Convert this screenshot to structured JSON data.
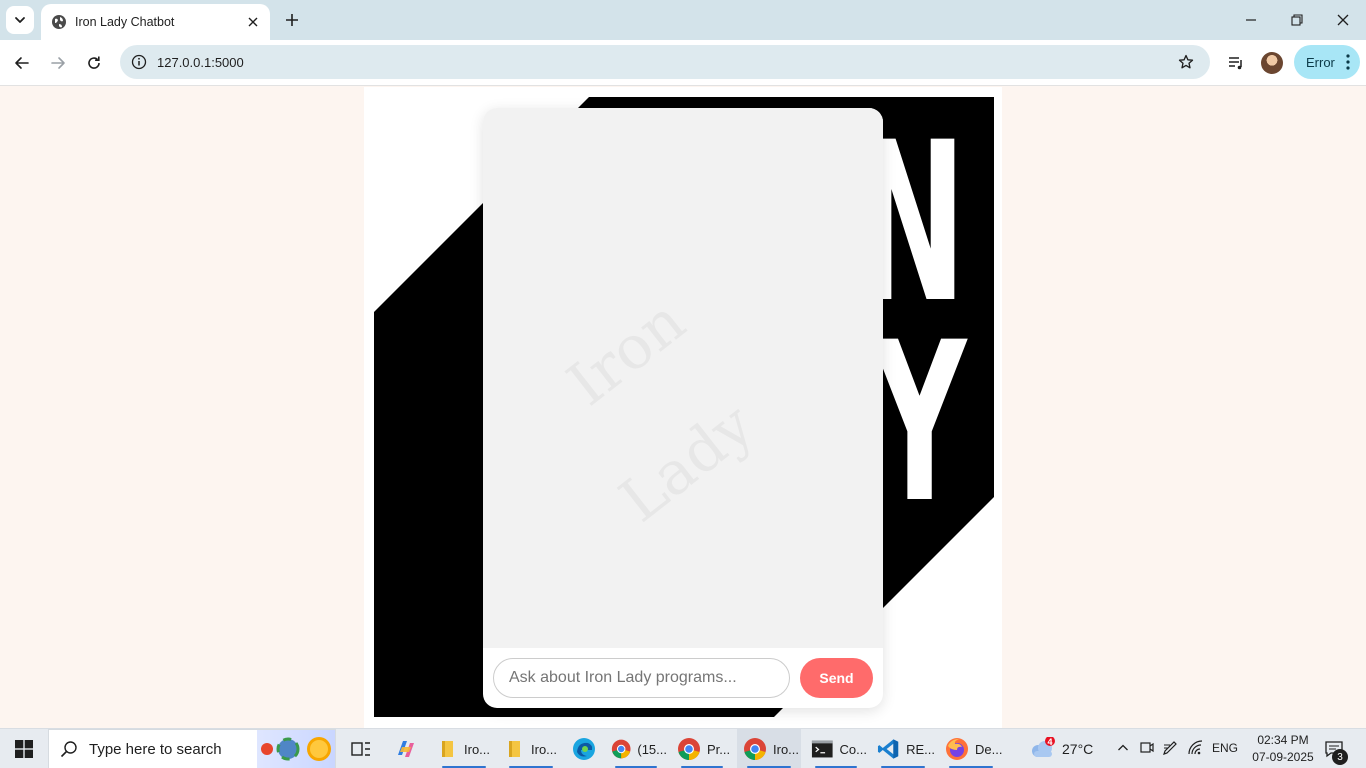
{
  "browser": {
    "tab": {
      "title": "Iron Lady Chatbot"
    },
    "address": {
      "url": "127.0.0.1:5000"
    },
    "profile_status": "Error"
  },
  "page": {
    "logo_text": [
      "IRON",
      "LADY"
    ],
    "watermark_text": [
      "Iron",
      "Lady"
    ],
    "chat": {
      "input_placeholder": "Ask about Iron Lady programs...",
      "input_value": "",
      "send_label": "Send"
    },
    "colors": {
      "accent": "#ff6b6b",
      "page_bg": "#fdf5f0",
      "logo_bg": "#000000"
    }
  },
  "taskbar": {
    "search_placeholder": "Type here to search",
    "apps": [
      {
        "name": "file-explorer",
        "label": "Iro..."
      },
      {
        "name": "file-explorer-2",
        "label": "Iro..."
      },
      {
        "name": "edge",
        "label": ""
      },
      {
        "name": "chrome-1",
        "label": "(15..."
      },
      {
        "name": "chrome-2",
        "label": "Pr..."
      },
      {
        "name": "chrome-3",
        "label": "Iro..."
      },
      {
        "name": "terminal",
        "label": "Co..."
      },
      {
        "name": "vscode",
        "label": "RE..."
      },
      {
        "name": "firefox",
        "label": "De..."
      }
    ],
    "weather": {
      "temp": "27°C",
      "badge": "4"
    },
    "language": "ENG",
    "time": "02:34 PM",
    "date": "07-09-2025",
    "notification_count": "3"
  }
}
